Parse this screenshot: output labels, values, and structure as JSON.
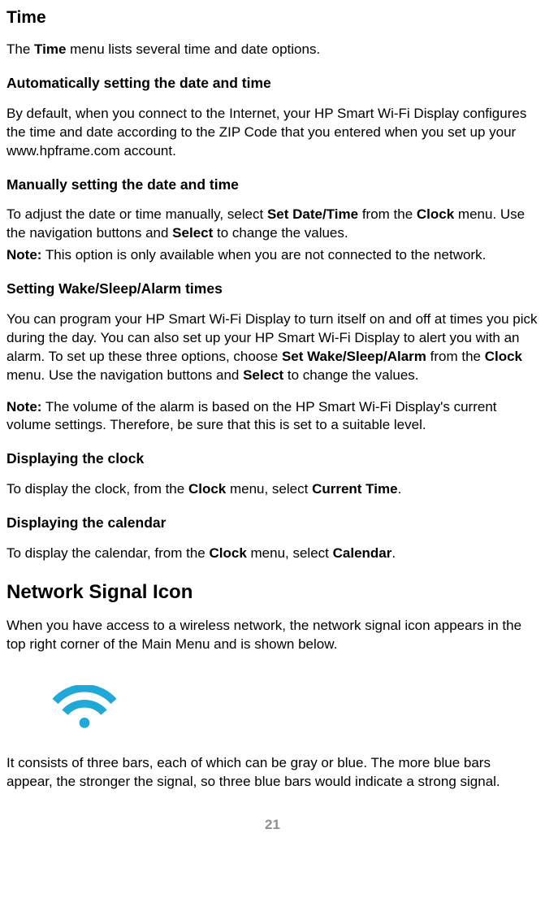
{
  "pageNumber": "21",
  "time": {
    "heading": "Time",
    "intro_pre": "The ",
    "intro_bold": "Time",
    "intro_post": " menu lists several time and date options.",
    "auto": {
      "heading": "Automatically setting the date and time",
      "body": "By default, when you connect to the Internet, your HP Smart Wi-Fi Display configures the time and date according to the ZIP Code that you entered when you set up your www.hpframe.com account."
    },
    "manual": {
      "heading": "Manually setting the date and time",
      "p1_a": "To adjust the date or time manually, select ",
      "p1_b1": "Set Date/Time",
      "p1_b": " from the ",
      "p1_b2": "Clock",
      "p1_c": " menu. Use the navigation buttons and ",
      "p1_b3": "Select",
      "p1_d": " to change the values.",
      "note_label": "Note:",
      "note_body": " This option is only available when you are not connected to the network."
    },
    "wake": {
      "heading": "Setting Wake/Sleep/Alarm times",
      "p1_a": "You can program your HP Smart Wi-Fi Display to turn itself on and off at times you pick during the day. You can also set up your HP Smart Wi-Fi Display to alert you with an alarm. To set up these three options, choose ",
      "p1_b1": "Set Wake/Sleep/Alarm",
      "p1_b": " from the ",
      "p1_b2": "Clock",
      "p1_c": " menu. Use the navigation buttons and ",
      "p1_b3": "Select",
      "p1_d": " to change the values.",
      "note_label": "Note:",
      "note_body": " The volume of the alarm is based on the HP Smart Wi-Fi Display's current volume settings. Therefore, be sure that this is set to a suitable level."
    },
    "clock": {
      "heading": "Displaying the clock",
      "a": "To display the clock, from the ",
      "b1": "Clock",
      "b": " menu, select ",
      "b2": "Current Time",
      "c": "."
    },
    "calendar": {
      "heading": "Displaying the calendar",
      "a": "To display the calendar, from the ",
      "b1": "Clock",
      "b": " menu, select ",
      "b2": "Calendar",
      "c": "."
    }
  },
  "network": {
    "heading": "Network Signal Icon",
    "p1": "When you have access to a wireless network, the network signal icon appears in the top right corner of the Main Menu and is shown below.",
    "p2": "It consists of three bars, each of which can be gray or blue. The more blue bars appear, the stronger the signal, so three blue bars would indicate a strong signal."
  }
}
